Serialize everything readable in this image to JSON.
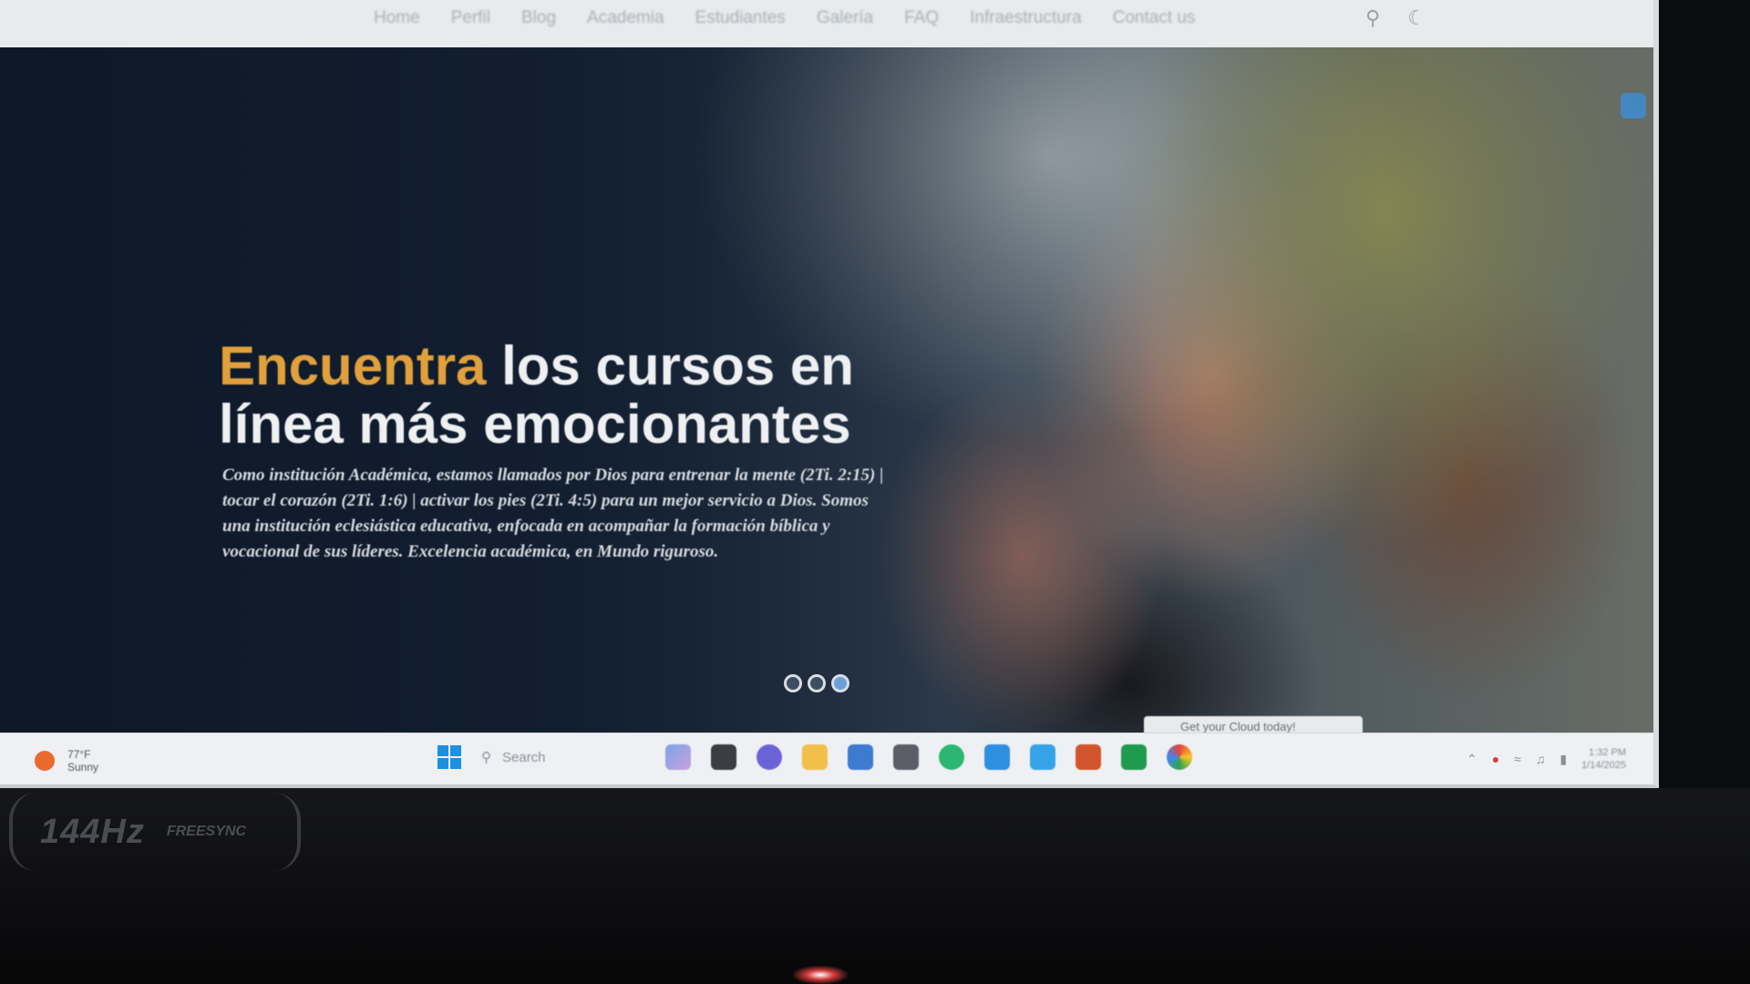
{
  "navbar": {
    "items": [
      "Home",
      "Perfil",
      "Blog",
      "Academia",
      "Estudiantes",
      "Galería",
      "FAQ",
      "Infraestructura",
      "Contact us"
    ]
  },
  "hero": {
    "title_accent": "Encuentra",
    "title_rest": " los cursos en línea más emocionantes",
    "description": "Como institución Académica, estamos llamados por Dios para entrenar la mente (2Ti. 2:15) | tocar el corazón (2Ti. 1:6) | activar los pies (2Ti. 4:5) para un mejor servicio a Dios. Somos una institución eclesiástica educativa, enfocada en acompañar la formación bíblica y vocacional de sus líderes. Excelencia académica, en Mundo riguroso.",
    "slides": 3,
    "active_slide": 3,
    "accent_color": "#e1a03c"
  },
  "toast": {
    "text": "Get your Cloud today!"
  },
  "taskbar": {
    "weather_temp": "77°F",
    "weather_condition": "Sunny",
    "search_placeholder": "Search",
    "apps": [
      "copilot-icon",
      "file-manager-icon",
      "chat-icon",
      "folder-icon",
      "store-icon",
      "calculator-icon",
      "spotify-icon",
      "vscode-icon",
      "mail-icon",
      "office-icon",
      "excel-icon",
      "chrome-icon"
    ],
    "time": "1:32 PM",
    "date": "1/14/2025"
  },
  "monitor": {
    "refresh": "144Hz",
    "sync_label": "FREESYNC"
  }
}
